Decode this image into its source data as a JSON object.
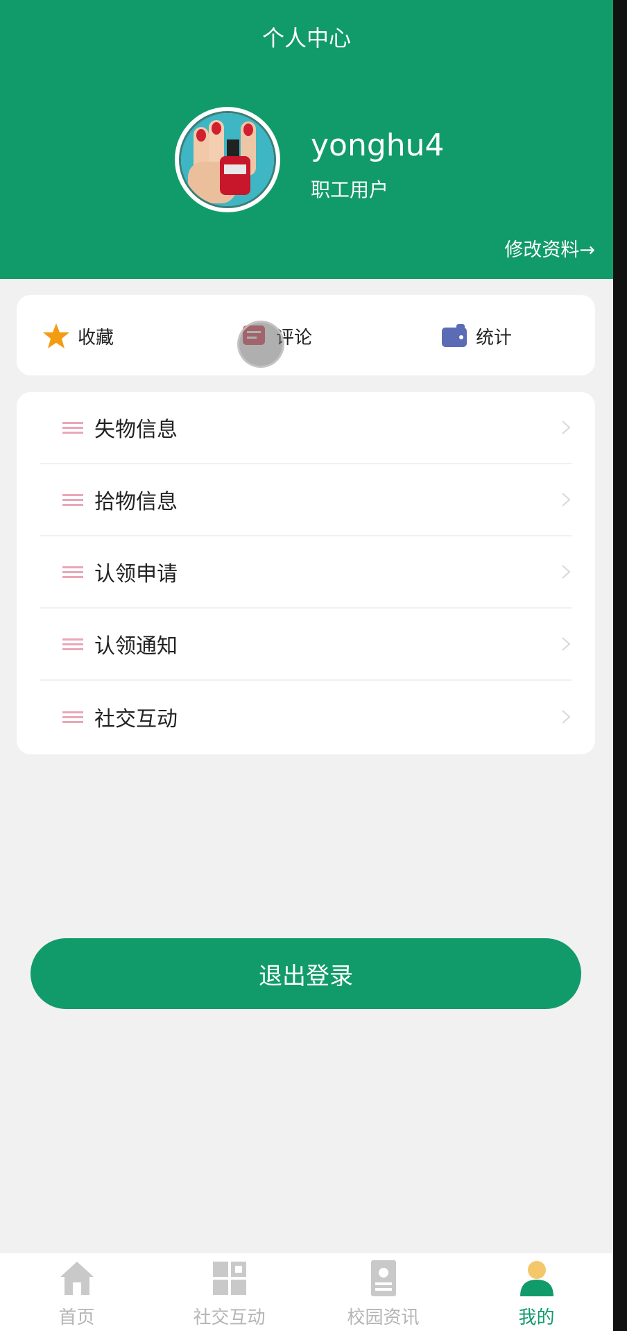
{
  "header": {
    "title": "个人中心",
    "username": "yonghu4",
    "role": "职工用户",
    "edit_link": "修改资料→"
  },
  "quick_actions": [
    {
      "label": "收藏",
      "icon": "star-icon"
    },
    {
      "label": "评论",
      "icon": "comment-icon"
    },
    {
      "label": "统计",
      "icon": "wallet-icon"
    }
  ],
  "menu": [
    {
      "label": "失物信息"
    },
    {
      "label": "拾物信息"
    },
    {
      "label": "认领申请"
    },
    {
      "label": "认领通知"
    },
    {
      "label": "社交互动"
    }
  ],
  "logout_label": "退出登录",
  "tabs": [
    {
      "label": "首页",
      "icon": "home-icon",
      "active": false
    },
    {
      "label": "社交互动",
      "icon": "grid-icon",
      "active": false
    },
    {
      "label": "校园资讯",
      "icon": "news-icon",
      "active": false
    },
    {
      "label": "我的",
      "icon": "user-icon",
      "active": true
    }
  ],
  "colors": {
    "primary": "#119b6b",
    "background": "#f1f1f1",
    "menu_icon": "#e9a7b8",
    "star": "#f39c12",
    "wallet": "#5b6bb5",
    "comment": "#e05a6a",
    "inactive_tab": "#b5b5b5"
  }
}
